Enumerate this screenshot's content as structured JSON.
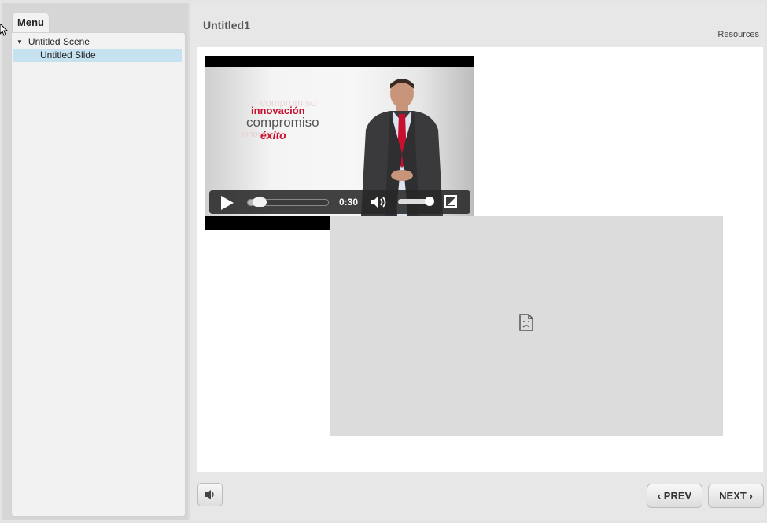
{
  "menu": {
    "tab_label": "Menu",
    "scene_label": "Untitled Scene",
    "slide_label": "Untitled Slide"
  },
  "header": {
    "title": "Untitled1",
    "resources_label": "Resources"
  },
  "video": {
    "overlay_text": [
      "innovación",
      "compromiso",
      "éxito"
    ],
    "time": "0:30",
    "progress": 0.1,
    "volume": 0.9
  },
  "footer": {
    "prev_label": "PREV",
    "next_label": "NEXT"
  },
  "colors": {
    "selected_row": "#c6e2f0",
    "brand_red": "#c8102e"
  }
}
